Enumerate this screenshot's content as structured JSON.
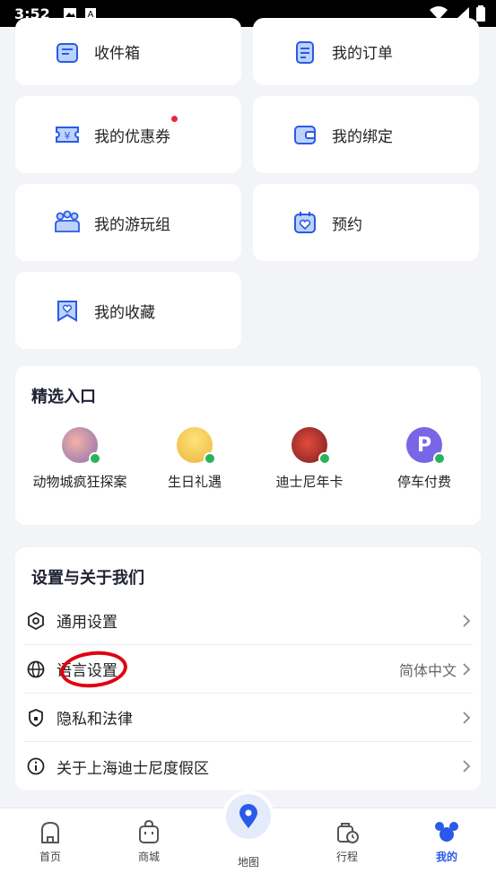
{
  "status_bar": {
    "time": "3:52"
  },
  "tiles": [
    {
      "id": "inbox",
      "label": "收件箱"
    },
    {
      "id": "orders",
      "label": "我的订单"
    },
    {
      "id": "coupons",
      "label": "我的优惠券",
      "badge": "dot"
    },
    {
      "id": "bindings",
      "label": "我的绑定"
    },
    {
      "id": "groups",
      "label": "我的游玩组"
    },
    {
      "id": "reservations",
      "label": "预约"
    },
    {
      "id": "favorites",
      "label": "我的收藏"
    }
  ],
  "featured": {
    "title": "精选入口",
    "items": [
      {
        "label": "动物城疯狂探案",
        "icon": "zootopia-avatar"
      },
      {
        "label": "生日礼遇",
        "icon": "birthday-cake-avatar"
      },
      {
        "label": "迪士尼年卡",
        "icon": "mickey-avatar"
      },
      {
        "label": "停车付费",
        "icon": "parking-p-avatar"
      }
    ]
  },
  "settings": {
    "title": "设置与关于我们",
    "rows": [
      {
        "label": "通用设置",
        "icon": "hexagon-settings-icon"
      },
      {
        "label": "语言设置",
        "value": "简体中文",
        "icon": "globe-icon"
      },
      {
        "label": "隐私和法律",
        "icon": "shield-lock-icon"
      },
      {
        "label": "关于上海迪士尼度假区",
        "icon": "info-icon"
      }
    ]
  },
  "tabbar": {
    "items": [
      {
        "label": "首页",
        "icon": "home-icon"
      },
      {
        "label": "商城",
        "icon": "shopping-bag-icon"
      },
      {
        "label": "地图",
        "icon": "map-pin-icon"
      },
      {
        "label": "行程",
        "icon": "clock-bag-icon"
      },
      {
        "label": "我的",
        "icon": "mickey-head-icon",
        "active": true
      }
    ]
  },
  "colors": {
    "accent": "#2b5ae8",
    "badge": "#e8283b",
    "annotation": "#e1000f",
    "background": "#f3f4f7"
  }
}
